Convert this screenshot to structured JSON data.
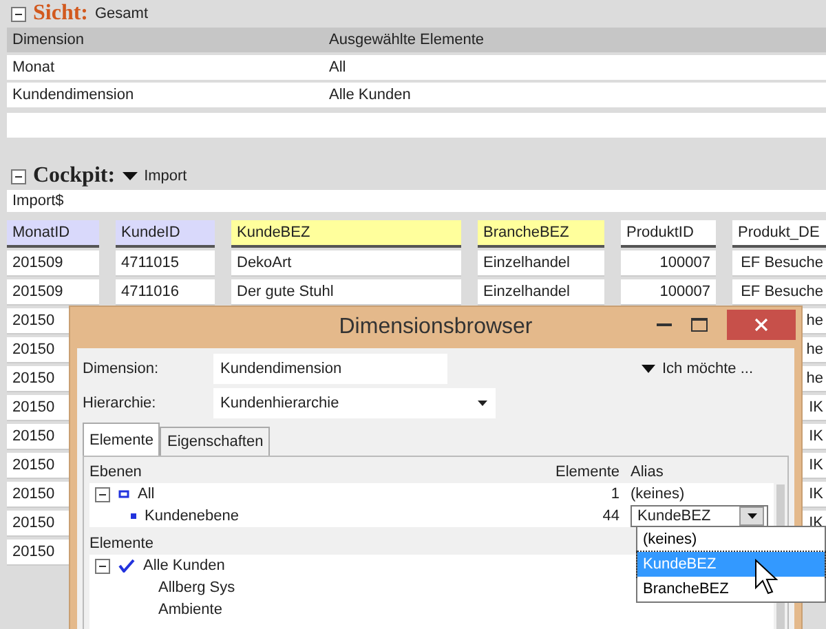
{
  "view": {
    "title": "Sicht:",
    "value": "Gesamt",
    "expanded": true,
    "columns": [
      "Dimension",
      "Ausgewählte Elemente"
    ],
    "rows": [
      [
        "Monat",
        "All"
      ],
      [
        "Kundendimension",
        "Alle Kunden"
      ]
    ]
  },
  "cockpit": {
    "title": "Cockpit:",
    "value": "Import",
    "expanded": true,
    "source": "Import$",
    "columns": [
      {
        "label": "MonatID",
        "color": "#d9d9fb"
      },
      {
        "label": "KundeID",
        "color": "#d9d9fb"
      },
      {
        "label": "KundeBEZ",
        "color": "#ffff9c"
      },
      {
        "label": "BrancheBEZ",
        "color": "#ffff9c"
      },
      {
        "label": "ProduktID",
        "color": "#ffffff"
      },
      {
        "label": "Produkt_DE",
        "color": "#ffffff"
      }
    ],
    "rows": [
      [
        "201509",
        "4711015",
        "DekoArt",
        "Einzelhandel",
        "100007",
        "EF Besuche"
      ],
      [
        "201509",
        "4711016",
        "Der gute Stuhl",
        "Einzelhandel",
        "100007",
        "EF Besuche"
      ],
      [
        "20150",
        null,
        null,
        null,
        null,
        "he"
      ],
      [
        "20150",
        null,
        null,
        null,
        null,
        "he"
      ],
      [
        "20150",
        null,
        null,
        null,
        null,
        "he"
      ],
      [
        "20150",
        null,
        null,
        null,
        null,
        "IK"
      ],
      [
        "20150",
        null,
        null,
        null,
        null,
        "IK"
      ],
      [
        "20150",
        null,
        null,
        null,
        null,
        "IK"
      ],
      [
        "20150",
        null,
        null,
        null,
        null,
        "IK"
      ],
      [
        "20150",
        null,
        null,
        null,
        null,
        "IK"
      ],
      [
        "20150",
        null,
        null,
        null,
        null,
        null
      ]
    ]
  },
  "dialog": {
    "title": "Dimensionsbrowser",
    "dimension_label": "Dimension:",
    "dimension_value": "Kundendimension",
    "action": "Ich möchte ...",
    "hierarchy_label": "Hierarchie:",
    "hierarchy_value": "Kundenhierarchie",
    "tabs": [
      {
        "label": "Elemente",
        "selected": true
      },
      {
        "label": "Eigenschaften",
        "selected": false
      }
    ],
    "levels": {
      "columns": [
        "Ebenen",
        "Elemente",
        "Alias"
      ],
      "items": [
        {
          "label": "All",
          "count": "1",
          "alias": "(keines)",
          "kind": "text",
          "expanded": true,
          "children": [
            {
              "label": "Kundenebene",
              "count": "44",
              "alias": "KundeBEZ",
              "kind": "combo"
            }
          ]
        }
      ]
    },
    "elements": {
      "title": "Elemente",
      "items": [
        {
          "label": "Alle Kunden",
          "checked": true,
          "expanded": true,
          "children": [
            {
              "label": "Allberg Sys"
            },
            {
              "label": "Ambiente"
            }
          ]
        }
      ]
    },
    "alias_options": [
      {
        "label": "(keines)",
        "selected": false
      },
      {
        "label": "KundeBEZ",
        "selected": true
      },
      {
        "label": "BrancheBEZ",
        "selected": false
      }
    ]
  }
}
